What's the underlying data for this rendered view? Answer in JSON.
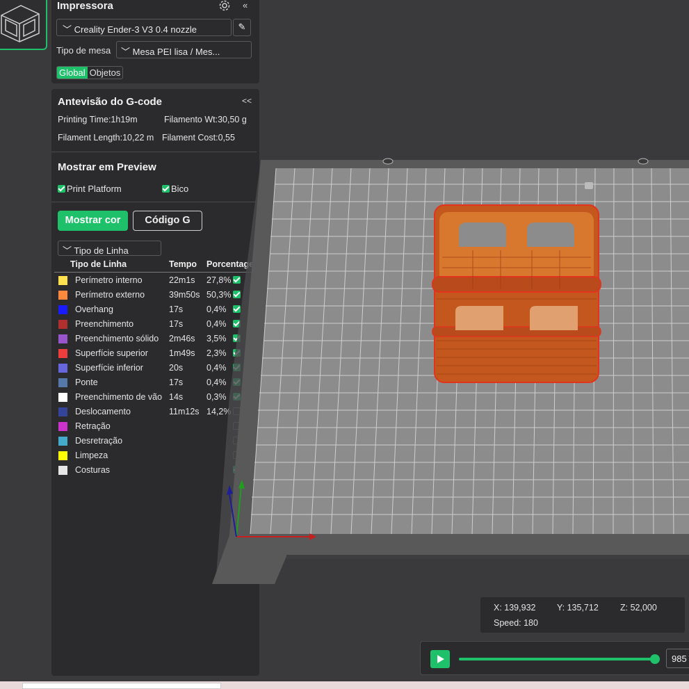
{
  "printer_panel": {
    "title": "Impressora",
    "printer": "Creality Ender-3 V3 0.4 nozzle",
    "bed_label": "Tipo de mesa",
    "bed_value": "Mesa PEI lisa / Mes...",
    "tabs": [
      "Global",
      "Objetos"
    ]
  },
  "gcode_panel": {
    "title": "Antevisão do G-code",
    "collapse": "<<",
    "printing_time": "Printing Time:1h19m",
    "filament_weight": "Filamento Wt:30,50 g",
    "filament_length": "Filament Length:10,22 m",
    "filament_cost": "Filament Cost:0,55",
    "show_title": "Mostrar em Preview",
    "show_options": [
      "Print Platform",
      "Bico"
    ],
    "btn_color": "Mostrar cor",
    "btn_gcode": "Código G",
    "view_select": "Tipo de Linha",
    "headers": [
      "Tipo de Linha",
      "Tempo",
      "Porcentage"
    ],
    "rows": [
      {
        "name": "Perímetro interno",
        "time": "22m1s",
        "pct": "27,8%",
        "color": "#ffe14d",
        "checked": true
      },
      {
        "name": "Perímetro externo",
        "time": "39m50s",
        "pct": "50,3%",
        "color": "#ff8a3d",
        "checked": true
      },
      {
        "name": "Overhang",
        "time": "17s",
        "pct": "0,4%",
        "color": "#1a1aff",
        "checked": true
      },
      {
        "name": "Preenchimento",
        "time": "17s",
        "pct": "0,4%",
        "color": "#b03030",
        "checked": true
      },
      {
        "name": "Preenchimento sólido",
        "time": "2m46s",
        "pct": "3,5%",
        "color": "#9955cc",
        "checked": true
      },
      {
        "name": "Superfície superior",
        "time": "1m49s",
        "pct": "2,3%",
        "color": "#ee3d3d",
        "checked": true
      },
      {
        "name": "Superfície inferior",
        "time": "20s",
        "pct": "0,4%",
        "color": "#6666dd",
        "checked": true
      },
      {
        "name": "Ponte",
        "time": "17s",
        "pct": "0,4%",
        "color": "#5577aa",
        "checked": true
      },
      {
        "name": "Preenchimento de vão",
        "time": "14s",
        "pct": "0,3%",
        "color": "#ffffff",
        "checked": true
      },
      {
        "name": "Deslocamento",
        "time": "11m12s",
        "pct": "14,2%",
        "color": "#334499",
        "checked": false
      },
      {
        "name": "Retração",
        "time": "",
        "pct": "",
        "color": "#cc33cc",
        "checked": false
      },
      {
        "name": "Desretração",
        "time": "",
        "pct": "",
        "color": "#44aacc",
        "checked": false
      },
      {
        "name": "Limpeza",
        "time": "",
        "pct": "",
        "color": "#ffff00",
        "checked": false
      },
      {
        "name": "Costuras",
        "time": "",
        "pct": "",
        "color": "#e6e6e6",
        "checked": true
      }
    ]
  },
  "coords": {
    "x": "X: 139,932",
    "y": "Y: 135,712",
    "z": "Z: 52,000",
    "speed": "Speed: 180"
  },
  "playbar": {
    "layer": "985"
  }
}
